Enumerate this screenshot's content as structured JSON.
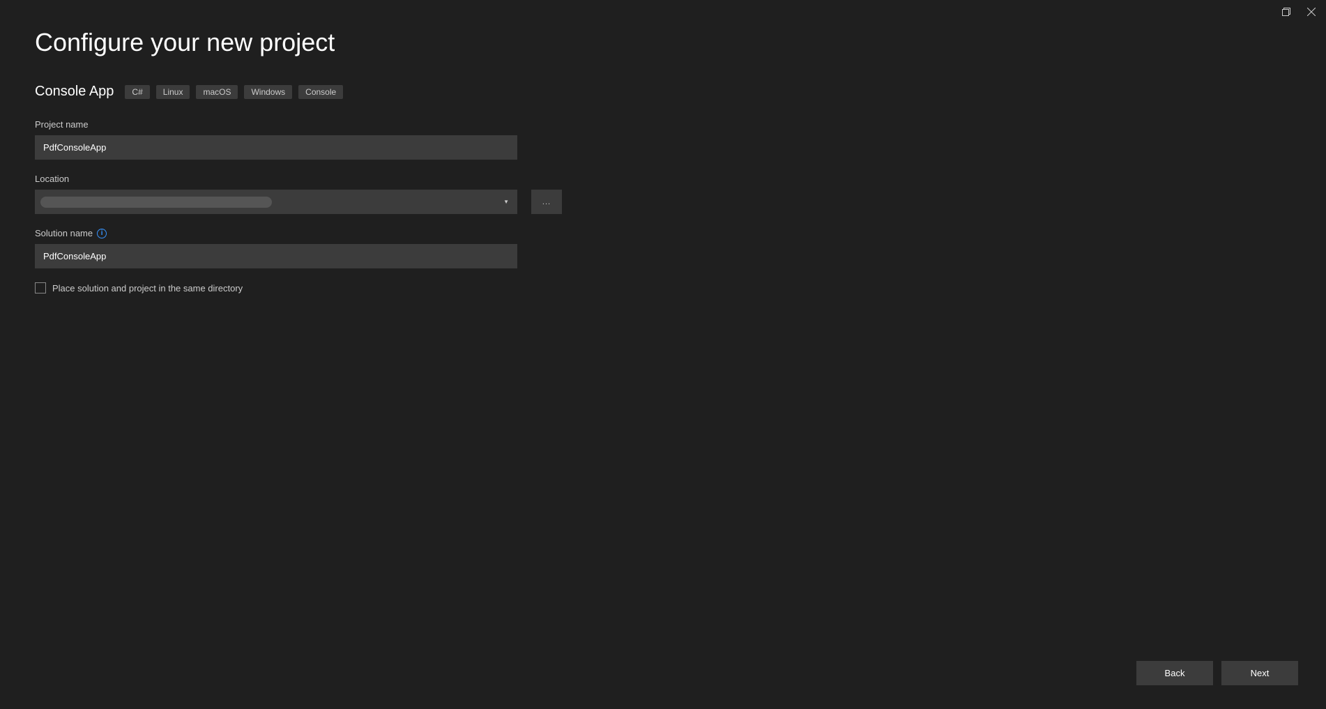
{
  "titlebar": {
    "maximize_label": "maximize",
    "close_label": "close"
  },
  "header": {
    "title": "Configure your new project",
    "template_name": "Console App",
    "tags": [
      "C#",
      "Linux",
      "macOS",
      "Windows",
      "Console"
    ]
  },
  "form": {
    "project_name": {
      "label": "Project name",
      "value": "PdfConsoleApp"
    },
    "location": {
      "label": "Location",
      "value": "",
      "browse_label": "..."
    },
    "solution_name": {
      "label": "Solution name",
      "info_tooltip": "i",
      "value": "PdfConsoleApp"
    },
    "same_directory_checkbox": {
      "checked": false,
      "label": "Place solution and project in the same directory"
    }
  },
  "footer": {
    "back_label": "Back",
    "next_label": "Next"
  }
}
